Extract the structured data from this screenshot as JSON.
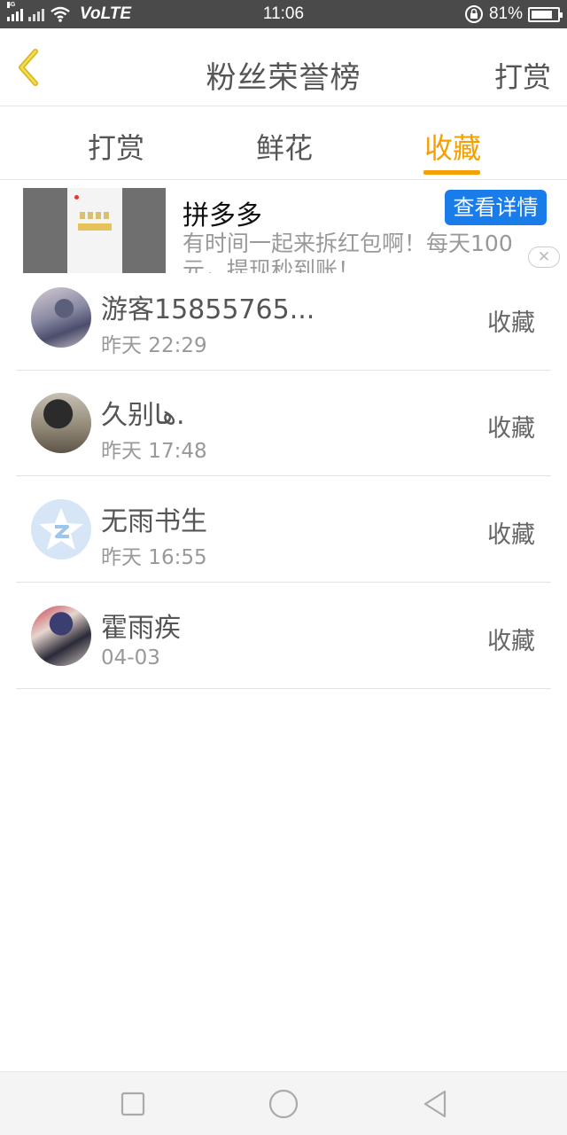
{
  "status_bar": {
    "network_tag": "4G",
    "volte": "VoLTE",
    "time": "11:06",
    "battery": "81%",
    "battery_level": 0.81
  },
  "header": {
    "title": "粉丝荣誉榜",
    "action_label": "打赏"
  },
  "tabs": [
    {
      "label": "打赏",
      "active": false
    },
    {
      "label": "鲜花",
      "active": false
    },
    {
      "label": "收藏",
      "active": true
    }
  ],
  "ad": {
    "title": "拼多多",
    "description_line1": "有时间一起来拆红包啊！每天100",
    "description_line2": "元，提现秒到账！",
    "button_label": "查看详情",
    "close_symbol": "✕"
  },
  "fans": [
    {
      "name": "游客15855765...",
      "time": "昨天 22:29",
      "action": "收藏"
    },
    {
      "name": "久别ها.",
      "time": "昨天 17:48",
      "action": "收藏"
    },
    {
      "name": "无雨书生",
      "time": "昨天 16:55",
      "action": "收藏"
    },
    {
      "name": "霍雨疾",
      "time": "04-03",
      "action": "收藏"
    }
  ],
  "colors": {
    "accent": "#f5a000",
    "status_bar": "#4a4a4a",
    "ad_button": "#1a7ce8"
  },
  "icons": {
    "back": "chevron-left-icon",
    "nav_recent": "square-icon",
    "nav_home": "circle-icon",
    "nav_back": "triangle-back-icon"
  }
}
